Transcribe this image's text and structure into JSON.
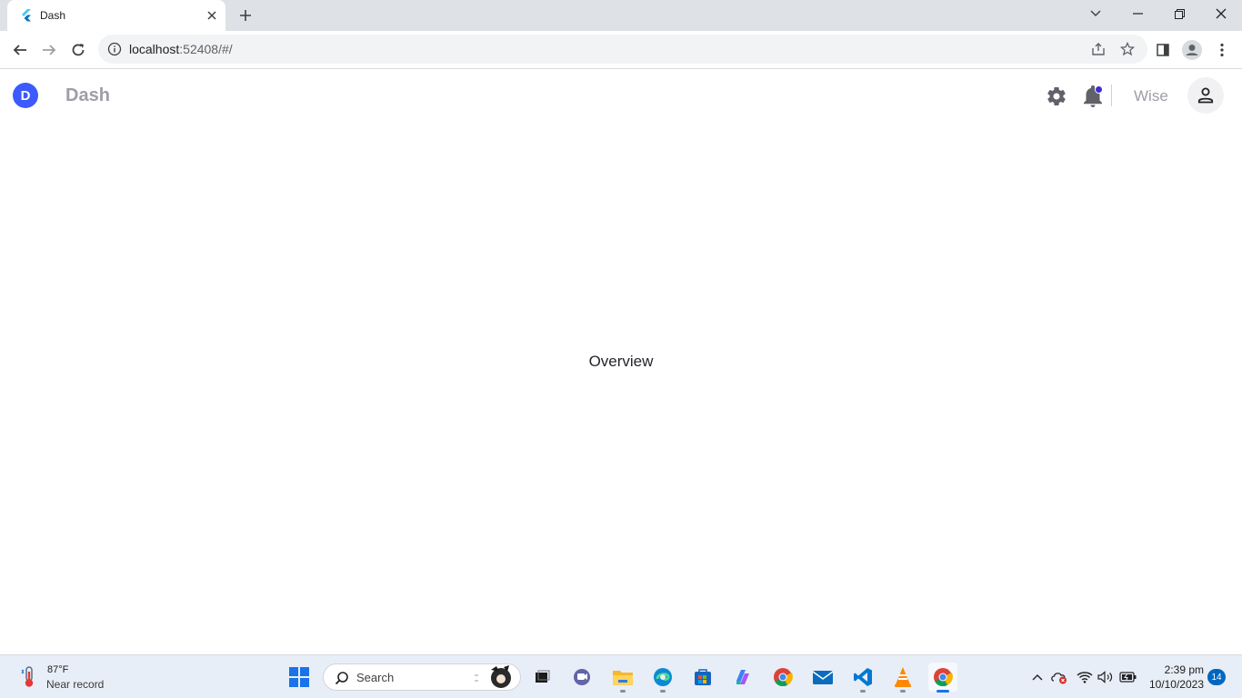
{
  "browser": {
    "tab_title": "Dash",
    "url_host": "localhost",
    "url_rest": ":52408/#/"
  },
  "app": {
    "logo_letter": "D",
    "title": "Dash",
    "username": "Wise",
    "content_title": "Overview",
    "accent_color": "#3d5afe",
    "notification_dot_color": "#3d2bd6"
  },
  "taskbar": {
    "weather_temp": "87°F",
    "weather_desc": "Near record",
    "search_placeholder": "Search",
    "clock_time": "2:39 pm",
    "clock_date": "10/10/2023",
    "notification_count": "14",
    "apps": [
      "start-icon",
      "search-icon",
      "task-view-icon",
      "teams-chat-icon",
      "file-explorer-icon",
      "edge-icon",
      "store-icon",
      "copilot-icon",
      "chrome-icon",
      "mail-icon",
      "vscode-icon",
      "vlc-icon",
      "chrome-active-icon"
    ]
  }
}
